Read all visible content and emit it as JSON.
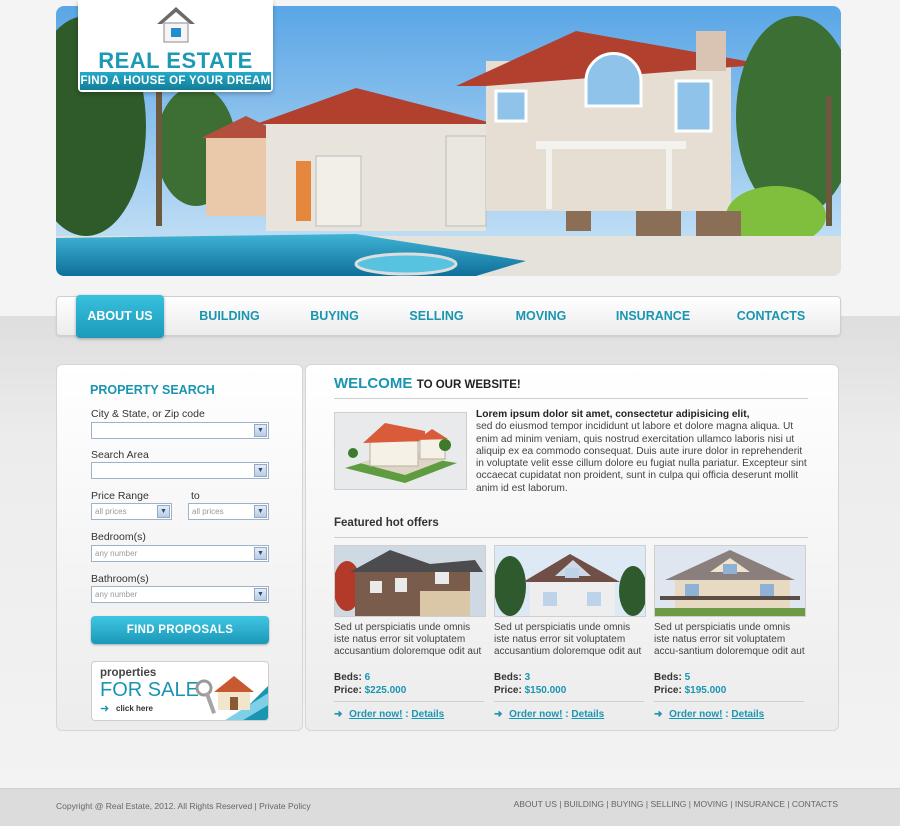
{
  "brand": {
    "title": "REAL ESTATE",
    "tagline": "FIND A HOUSE OF YOUR DREAM"
  },
  "nav": [
    "ABOUT US",
    "BUILDING",
    "BUYING",
    "SELLING",
    "MOVING",
    "INSURANCE",
    "CONTACTS"
  ],
  "search": {
    "title": "PROPERTY SEARCH",
    "city_label": "City & State, or Zip code",
    "area_label": "Search Area",
    "price_label": "Price Range",
    "to_label": "to",
    "price_from": "all prices",
    "price_to": "all prices",
    "bedroom_label": "Bedroom(s)",
    "bedroom_value": "any number",
    "bathroom_label": "Bathroom(s)",
    "bathroom_value": "any number",
    "button": "FIND PROPOSALS"
  },
  "banner": {
    "small": "properties",
    "big": "FOR SALE",
    "click": "click here"
  },
  "welcome": {
    "strong": "WELCOME",
    "rest": "TO OUR WEBSITE!",
    "lead": "Lorem ipsum dolor sit amet, consectetur adipisicing elit,",
    "body": "sed do eiusmod tempor incididunt ut labore et dolore magna aliqua. Ut enim ad minim veniam, quis nostrud exercitation ullamco laboris nisi ut aliquip ex ea commodo consequat. Duis aute irure dolor in reprehenderit in voluptate velit esse cillum dolore eu fugiat nulla pariatur. Excepteur sint occaecat cupidatat non proident, sunt in culpa qui officia deserunt mollit anim id est laborum."
  },
  "featured": {
    "title": "Featured hot offers",
    "offers": [
      {
        "desc": "Sed ut perspiciatis unde omnis iste natus error sit voluptatem accusantium doloremque odit aut",
        "beds": "6",
        "price": "$225.000"
      },
      {
        "desc": "Sed ut perspiciatis unde omnis iste natus error sit voluptatem accusantium doloremque odit aut",
        "beds": "3",
        "price": "$150.000"
      },
      {
        "desc": "Sed ut perspiciatis unde omnis iste natus error sit voluptatem accu-santium doloremque odit aut",
        "beds": "5",
        "price": "$195.000"
      }
    ],
    "beds_label": "Beds:",
    "price_label": "Price:",
    "order_label": "Order now!",
    "colon": ":",
    "details_label": "Details"
  },
  "footer": {
    "copyright": "Copyright @ Real Estate, 2012. All Rights Reserved | Private Policy",
    "links": [
      "ABOUT US",
      "BUILDING",
      "BUYING",
      "SELLING",
      "MOVING",
      "INSURANCE",
      "CONTACTS"
    ],
    "separator": "|"
  },
  "colors": {
    "accent": "#1a95b1",
    "accent_light": "#38c0dd"
  }
}
